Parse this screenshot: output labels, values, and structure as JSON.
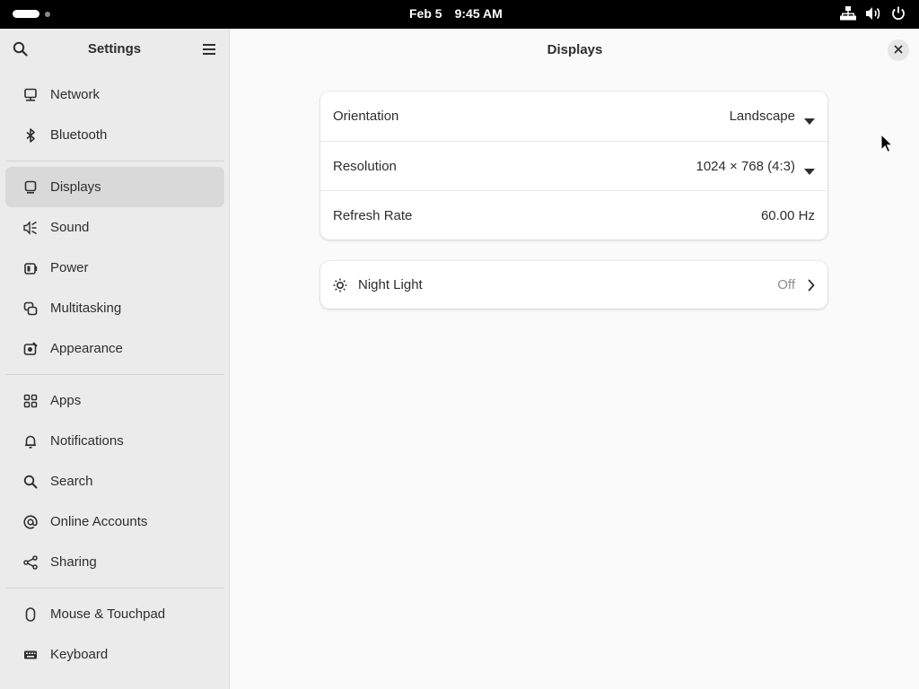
{
  "topbar": {
    "date": "Feb 5",
    "time": "9:45 AM"
  },
  "sidebar": {
    "title": "Settings",
    "groups": [
      [
        {
          "label": "Network",
          "icon": "network-icon"
        },
        {
          "label": "Bluetooth",
          "icon": "bluetooth-icon"
        }
      ],
      [
        {
          "label": "Displays",
          "icon": "display-icon",
          "active": true
        },
        {
          "label": "Sound",
          "icon": "sound-icon"
        },
        {
          "label": "Power",
          "icon": "power-plug-icon"
        },
        {
          "label": "Multitasking",
          "icon": "multitasking-icon"
        },
        {
          "label": "Appearance",
          "icon": "appearance-icon"
        }
      ],
      [
        {
          "label": "Apps",
          "icon": "apps-grid-icon"
        },
        {
          "label": "Notifications",
          "icon": "bell-icon"
        },
        {
          "label": "Search",
          "icon": "search-icon"
        },
        {
          "label": "Online Accounts",
          "icon": "at-sign-icon"
        },
        {
          "label": "Sharing",
          "icon": "share-icon"
        }
      ],
      [
        {
          "label": "Mouse & Touchpad",
          "icon": "mouse-icon"
        },
        {
          "label": "Keyboard",
          "icon": "keyboard-icon"
        }
      ]
    ]
  },
  "main": {
    "title": "Displays",
    "settings": {
      "orientation": {
        "label": "Orientation",
        "value": "Landscape"
      },
      "resolution": {
        "label": "Resolution",
        "value": "1024 × 768 (4:3)"
      },
      "refresh_rate": {
        "label": "Refresh Rate",
        "value": "60.00 Hz"
      }
    },
    "night_light": {
      "label": "Night Light",
      "value": "Off"
    }
  }
}
